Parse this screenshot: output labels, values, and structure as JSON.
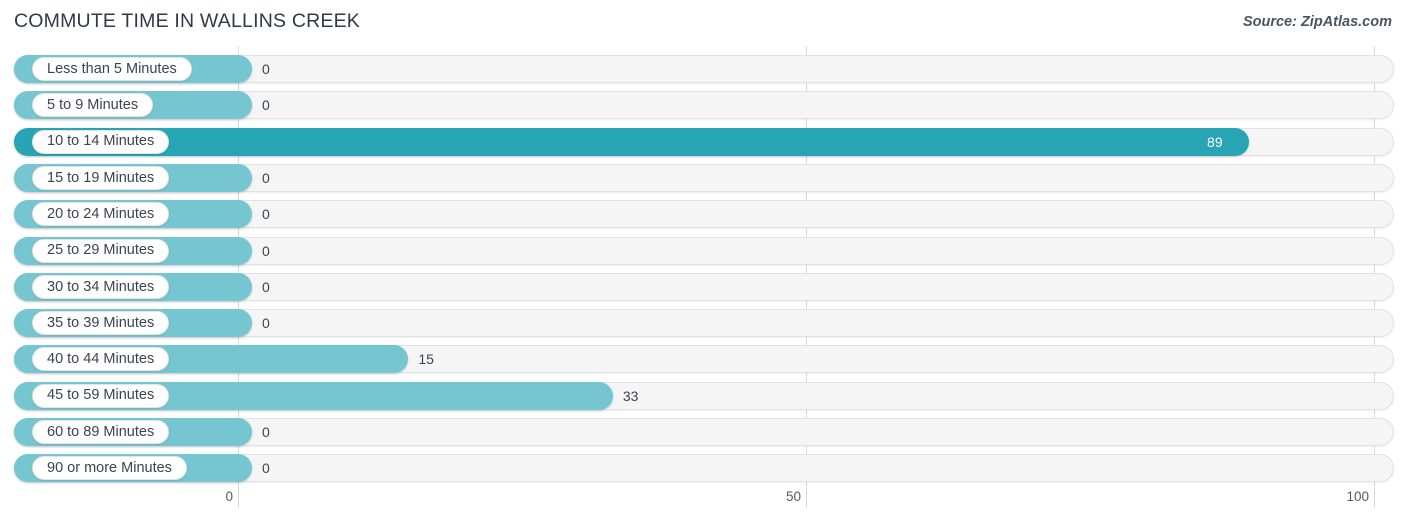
{
  "header": {
    "title": "COMMUTE TIME IN WALLINS CREEK",
    "source": "Source: ZipAtlas.com"
  },
  "colors": {
    "bar_light": "#76c6d2",
    "bar_dark": "#27a5b5",
    "track": "#f5f5f5",
    "track_border": "#e2e2e2",
    "grid": "#d9d9d9",
    "text": "#3a4450",
    "value_in_bar": "#ffffff"
  },
  "axis": {
    "ticks": [
      {
        "label": "0",
        "value": 0
      },
      {
        "label": "50",
        "value": 50
      },
      {
        "label": "100",
        "value": 100
      }
    ],
    "min": 0,
    "max": 100
  },
  "chart_data": {
    "type": "bar",
    "orientation": "horizontal",
    "title": "COMMUTE TIME IN WALLINS CREEK",
    "subtitle": "Source: ZipAtlas.com",
    "xlabel": "",
    "ylabel": "",
    "xlim": [
      0,
      100
    ],
    "grid": true,
    "legend": "none",
    "categories": [
      "Less than 5 Minutes",
      "5 to 9 Minutes",
      "10 to 14 Minutes",
      "15 to 19 Minutes",
      "20 to 24 Minutes",
      "25 to 29 Minutes",
      "30 to 34 Minutes",
      "35 to 39 Minutes",
      "40 to 44 Minutes",
      "45 to 59 Minutes",
      "60 to 89 Minutes",
      "90 or more Minutes"
    ],
    "values": [
      0,
      0,
      89,
      0,
      0,
      0,
      0,
      0,
      15,
      33,
      0,
      0
    ],
    "value_labels": [
      "0",
      "0",
      "89",
      "0",
      "0",
      "0",
      "0",
      "0",
      "15",
      "33",
      "0",
      "0"
    ]
  },
  "rows": [
    {
      "label": "Less than 5 Minutes",
      "value": 0,
      "value_label": "0",
      "highlight": false
    },
    {
      "label": "5 to 9 Minutes",
      "value": 0,
      "value_label": "0",
      "highlight": false
    },
    {
      "label": "10 to 14 Minutes",
      "value": 89,
      "value_label": "89",
      "highlight": true
    },
    {
      "label": "15 to 19 Minutes",
      "value": 0,
      "value_label": "0",
      "highlight": false
    },
    {
      "label": "20 to 24 Minutes",
      "value": 0,
      "value_label": "0",
      "highlight": false
    },
    {
      "label": "25 to 29 Minutes",
      "value": 0,
      "value_label": "0",
      "highlight": false
    },
    {
      "label": "30 to 34 Minutes",
      "value": 0,
      "value_label": "0",
      "highlight": false
    },
    {
      "label": "35 to 39 Minutes",
      "value": 0,
      "value_label": "0",
      "highlight": false
    },
    {
      "label": "40 to 44 Minutes",
      "value": 15,
      "value_label": "15",
      "highlight": false
    },
    {
      "label": "45 to 59 Minutes",
      "value": 33,
      "value_label": "33",
      "highlight": false
    },
    {
      "label": "60 to 89 Minutes",
      "value": 0,
      "value_label": "0",
      "highlight": false
    },
    {
      "label": "90 or more Minutes",
      "value": 0,
      "value_label": "0",
      "highlight": false
    }
  ]
}
